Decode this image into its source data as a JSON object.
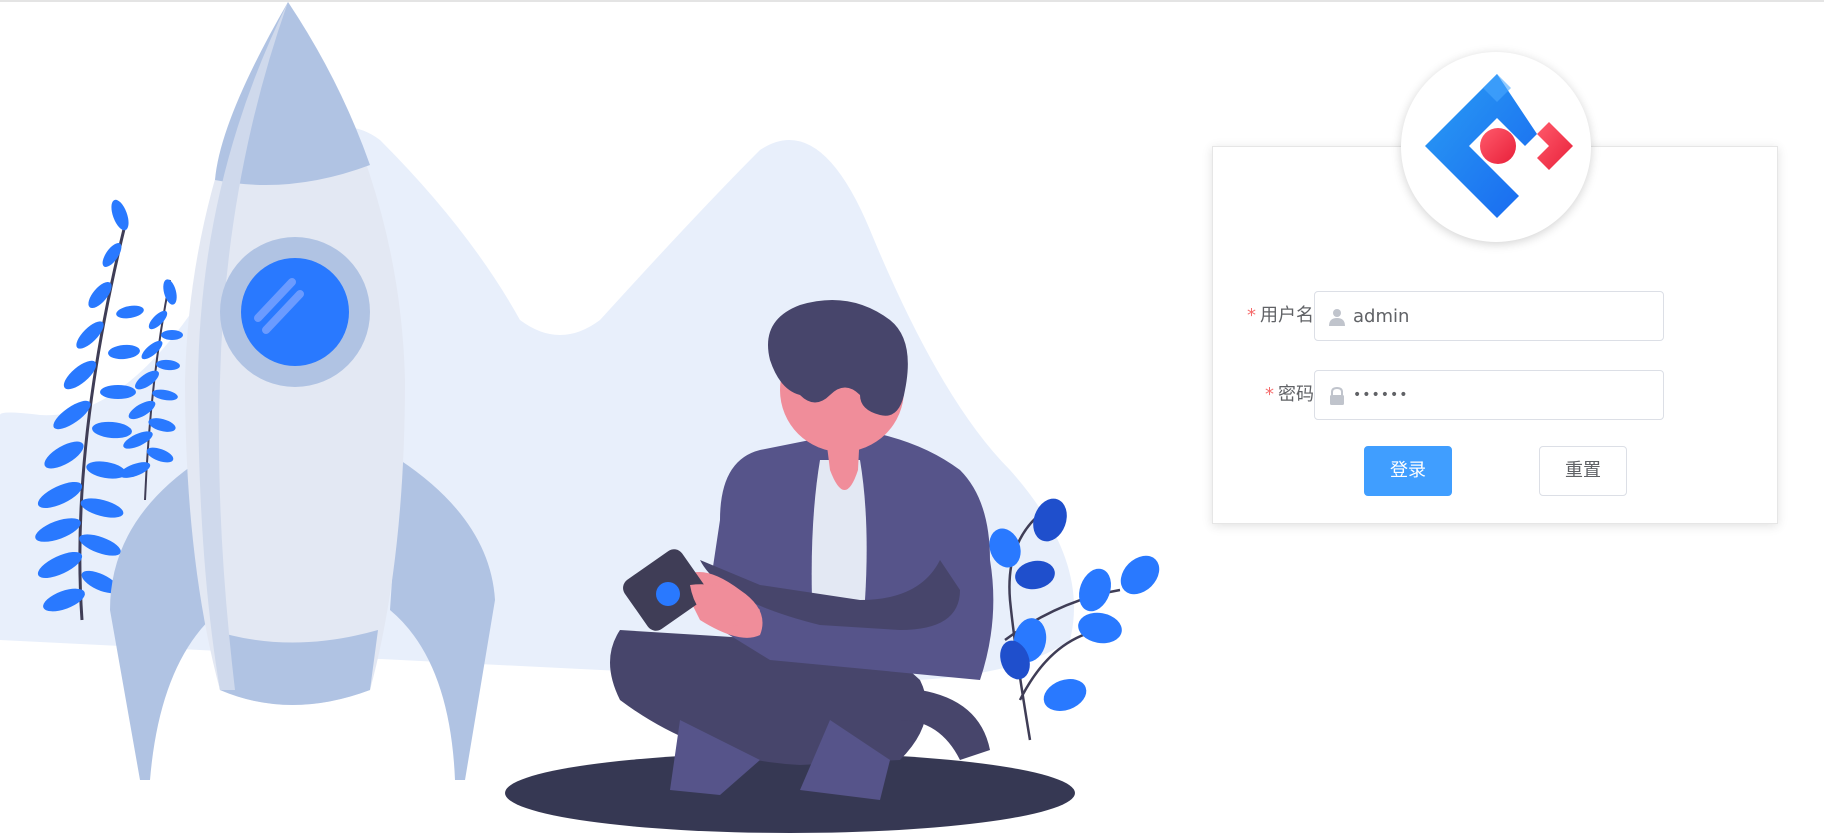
{
  "login": {
    "username_label": "用户名",
    "password_label": "密码",
    "required_mark": "*",
    "username_value": "admin",
    "password_value": "••••••",
    "login_button": "登录",
    "reset_button": "重置"
  },
  "icons": {
    "username": "user-icon",
    "password": "lock-icon",
    "logo": "ant-design-logo"
  },
  "colors": {
    "primary": "#409eff",
    "required": "#f56c6c",
    "illustration_accent": "#2979ff",
    "illustration_dark": "#3f3d56"
  }
}
